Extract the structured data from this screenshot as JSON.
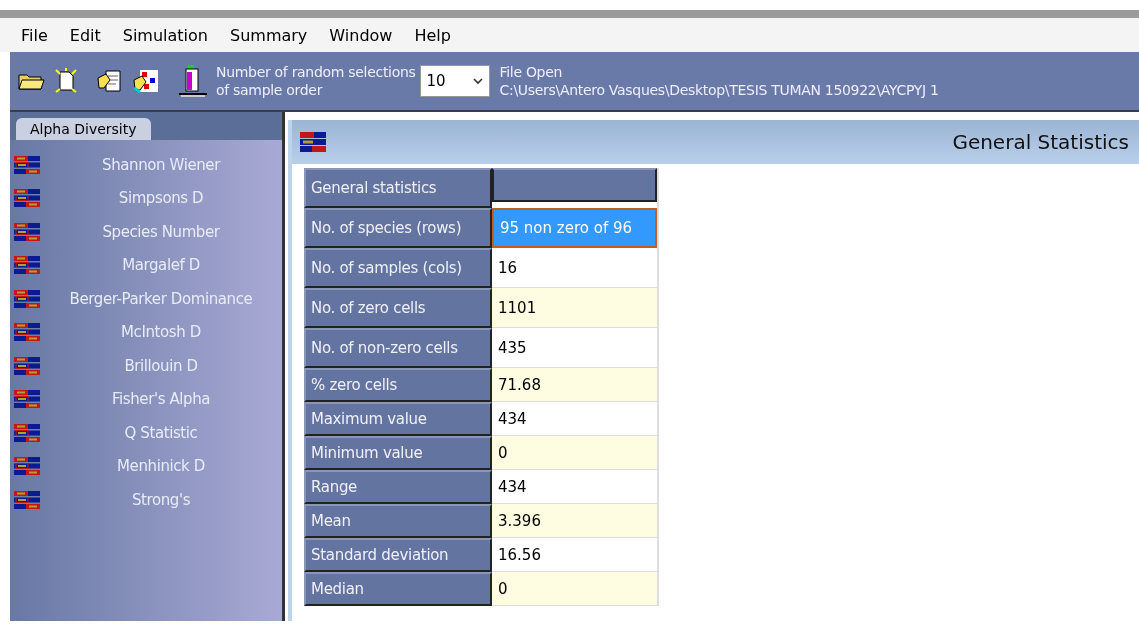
{
  "menu": [
    "File",
    "Edit",
    "Simulation",
    "Summary",
    "Window",
    "Help"
  ],
  "toolbar": {
    "selections_label": [
      "Number of random selections",
      "of sample order"
    ],
    "selections_value": "10",
    "file_status": "File Open",
    "file_path": "C:\\Users\\Antero Vasques\\Desktop\\TESIS TUMAN 150922\\AYCPYJ 1"
  },
  "sidebar": {
    "tab": "Alpha Diversity",
    "items": [
      "Shannon Wiener",
      "Simpsons D",
      "Species Number",
      "Margalef D",
      "Berger-Parker Dominance",
      "McIntosh D",
      "Brillouin D",
      "Fisher's Alpha",
      "Q Statistic",
      "Menhinick D",
      "Strong's"
    ]
  },
  "window": {
    "title": "General Statistics"
  },
  "table": {
    "header": "General statistics",
    "rows": [
      {
        "label": "No. of species (rows)",
        "value": "95 non zero of 96",
        "selected": true
      },
      {
        "label": "No. of samples (cols)",
        "value": "16",
        "selected": false
      },
      {
        "label": "No. of zero cells",
        "value": "1101",
        "selected": false
      },
      {
        "label": "No. of non-zero cells",
        "value": "435",
        "selected": false
      },
      {
        "label": "% zero cells",
        "value": "71.68",
        "selected": false
      },
      {
        "label": "Maximum value",
        "value": "434",
        "selected": false
      },
      {
        "label": "Minimum value",
        "value": "0",
        "selected": false
      },
      {
        "label": "Range",
        "value": "434",
        "selected": false
      },
      {
        "label": "Mean",
        "value": "3.396",
        "selected": false
      },
      {
        "label": "Standard deviation",
        "value": "16.56",
        "selected": false
      },
      {
        "label": "Median",
        "value": "0",
        "selected": false
      }
    ]
  }
}
